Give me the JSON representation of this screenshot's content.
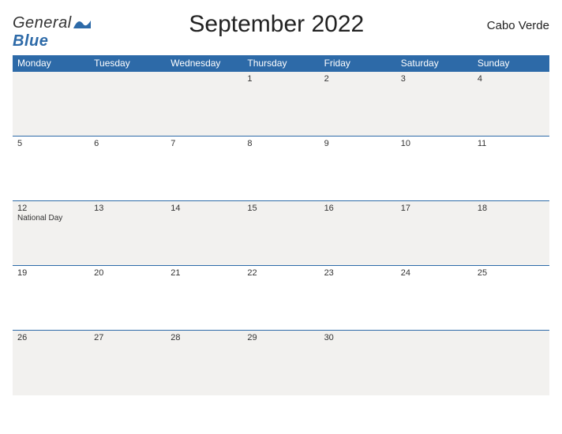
{
  "logo": {
    "word1": "General",
    "word2": "Blue"
  },
  "title": "September 2022",
  "country": "Cabo Verde",
  "weekdays": [
    "Monday",
    "Tuesday",
    "Wednesday",
    "Thursday",
    "Friday",
    "Saturday",
    "Sunday"
  ],
  "weeks": [
    [
      {
        "n": "",
        "h": ""
      },
      {
        "n": "",
        "h": ""
      },
      {
        "n": "",
        "h": ""
      },
      {
        "n": "1",
        "h": ""
      },
      {
        "n": "2",
        "h": ""
      },
      {
        "n": "3",
        "h": ""
      },
      {
        "n": "4",
        "h": ""
      }
    ],
    [
      {
        "n": "5",
        "h": ""
      },
      {
        "n": "6",
        "h": ""
      },
      {
        "n": "7",
        "h": ""
      },
      {
        "n": "8",
        "h": ""
      },
      {
        "n": "9",
        "h": ""
      },
      {
        "n": "10",
        "h": ""
      },
      {
        "n": "11",
        "h": ""
      }
    ],
    [
      {
        "n": "12",
        "h": "National Day"
      },
      {
        "n": "13",
        "h": ""
      },
      {
        "n": "14",
        "h": ""
      },
      {
        "n": "15",
        "h": ""
      },
      {
        "n": "16",
        "h": ""
      },
      {
        "n": "17",
        "h": ""
      },
      {
        "n": "18",
        "h": ""
      }
    ],
    [
      {
        "n": "19",
        "h": ""
      },
      {
        "n": "20",
        "h": ""
      },
      {
        "n": "21",
        "h": ""
      },
      {
        "n": "22",
        "h": ""
      },
      {
        "n": "23",
        "h": ""
      },
      {
        "n": "24",
        "h": ""
      },
      {
        "n": "25",
        "h": ""
      }
    ],
    [
      {
        "n": "26",
        "h": ""
      },
      {
        "n": "27",
        "h": ""
      },
      {
        "n": "28",
        "h": ""
      },
      {
        "n": "29",
        "h": ""
      },
      {
        "n": "30",
        "h": ""
      },
      {
        "n": "",
        "h": ""
      },
      {
        "n": "",
        "h": ""
      }
    ]
  ]
}
